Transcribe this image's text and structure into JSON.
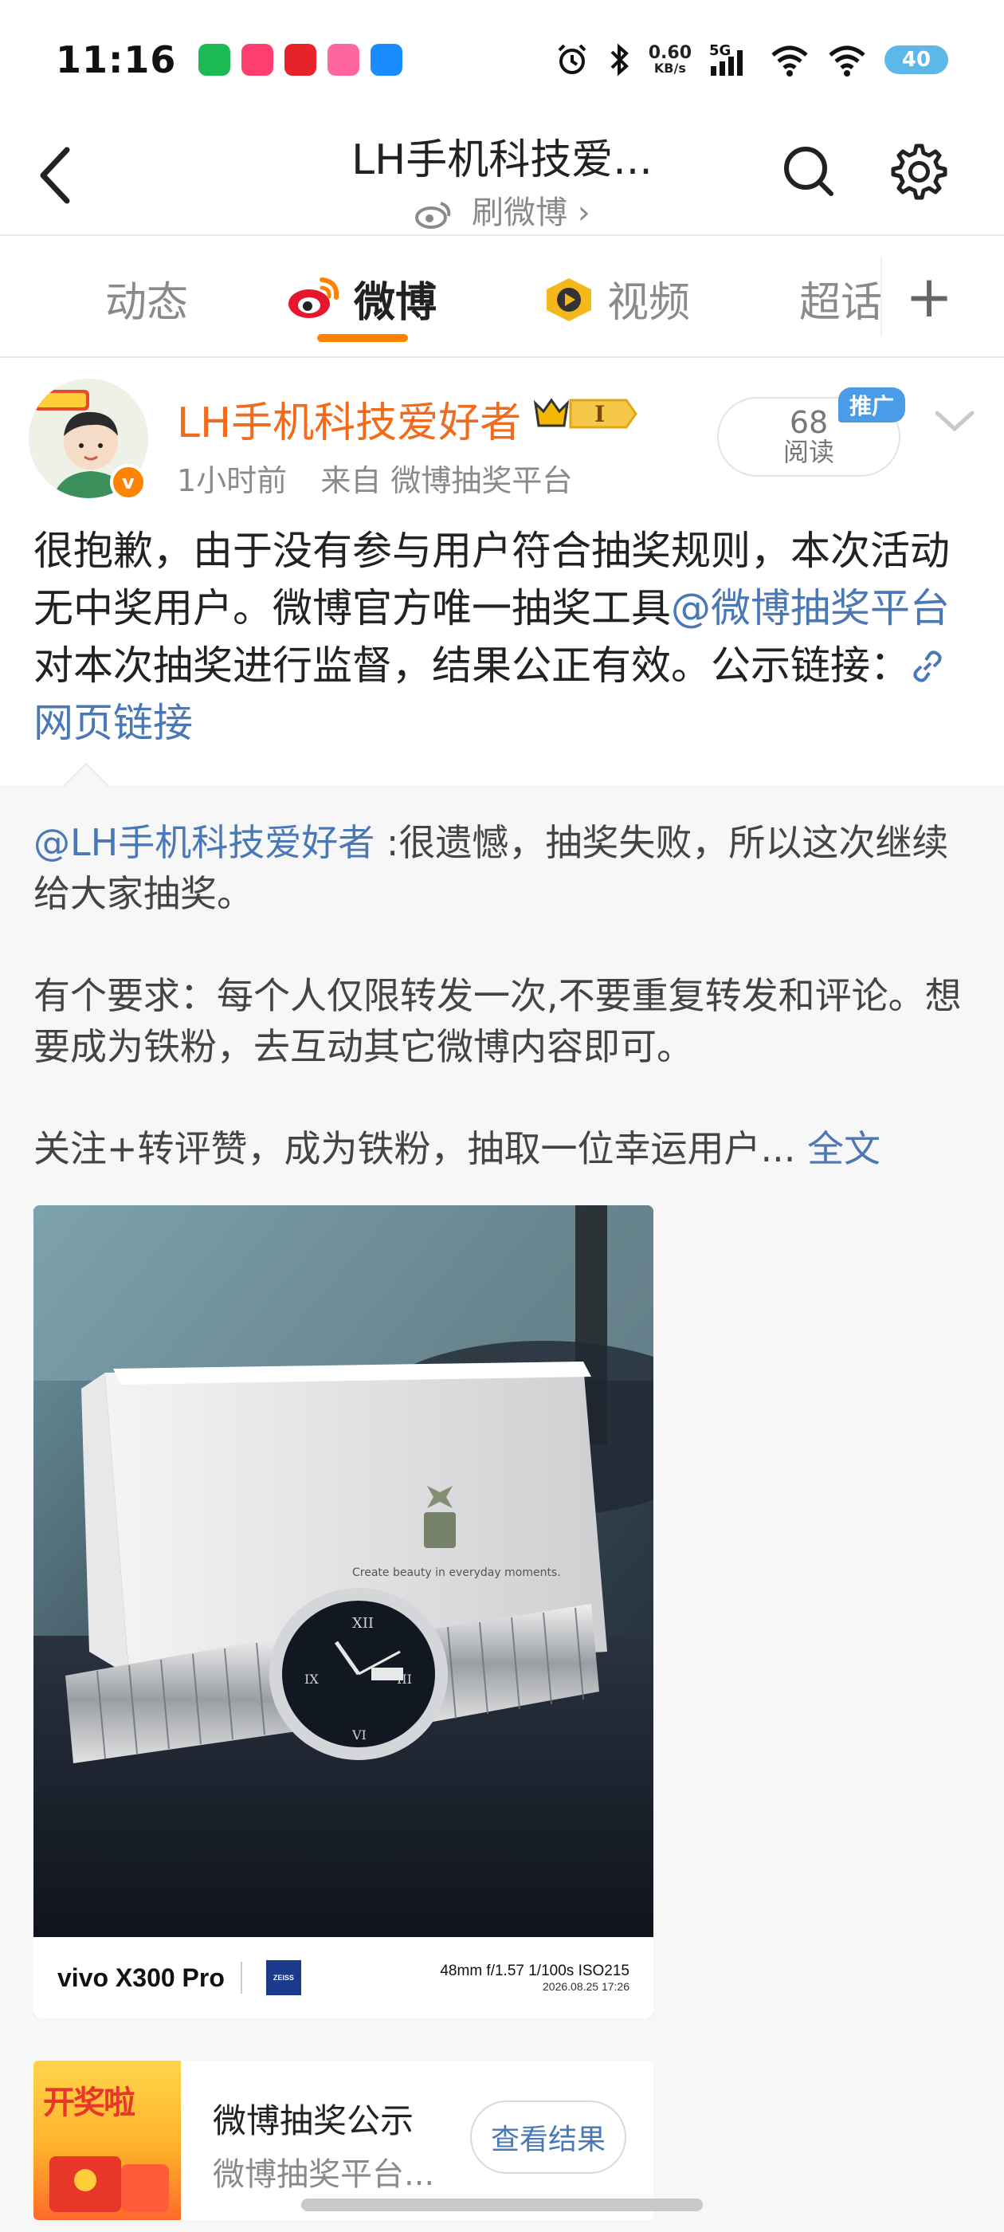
{
  "status_bar": {
    "time": "11:16",
    "net_speed_value": "0.60",
    "net_speed_unit": "KB/s",
    "signal_type": "5G",
    "battery": "40",
    "app_colors": [
      "#1db954",
      "#ff3d6e",
      "#e8222b",
      "#ff66a0",
      "#1a8cff"
    ]
  },
  "nav": {
    "title": "LH手机科技爱...",
    "subtitle": "刷微博",
    "subtitle_chevron": "›"
  },
  "tabs": [
    {
      "label": "动态"
    },
    {
      "label": "微博"
    },
    {
      "label": "视频"
    },
    {
      "label": "超话"
    }
  ],
  "tab_plus": "+",
  "post": {
    "author": "LH手机科技爱好者",
    "rank_level": "I",
    "verified_mark": "v",
    "time": "1小时前",
    "source": "来自 微博抽奖平台",
    "read_count": "68",
    "read_label": "阅读",
    "promo_label": "推广",
    "text_part1": "很抱歉，由于没有参与用户符合抽奖规则，本次活动无中奖用户。微博官方唯一抽奖工具",
    "mention": "@微博抽奖平台",
    "text_part2": " 对本次抽奖进行监督，结果公正有效。公示链接：",
    "web_link": "网页链接"
  },
  "repost": {
    "mention": "@LH手机科技爱好者",
    "line1": " :很遗憾，抽奖失败，所以这次继续给大家抽奖。",
    "para2": "有个要求：每个人仅限转发一次,不要重复转发和评论。想要成为铁粉，去互动其它微博内容即可。",
    "para3": "关注+转评赞，成为铁粉，抽取一位幸运用户... ",
    "full_text_link": "全文",
    "photo": {
      "camera_model": "vivo X300 Pro",
      "lens_brand": "ZEISS",
      "specs": "48mm  f/1.57  1/100s  ISO215",
      "datetime": "2026.08.25 17:26",
      "box_caption": "Create beauty in everyday moments."
    },
    "card": {
      "thumb_text": "开奖啦",
      "title": "微博抽奖公示",
      "subtitle": "微博抽奖平台...",
      "button": "查看结果"
    }
  }
}
